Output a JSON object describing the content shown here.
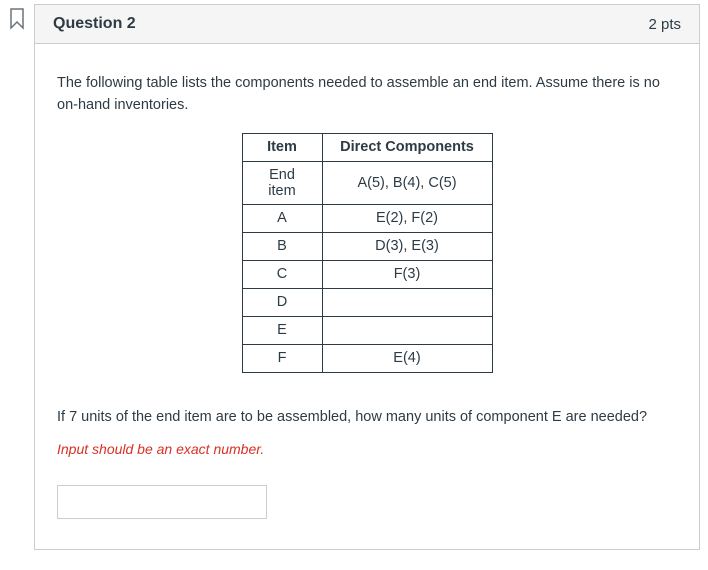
{
  "header": {
    "title": "Question 2",
    "points": "2 pts"
  },
  "body": {
    "intro": "The following table lists the components needed to assemble an end item. Assume there is no on-hand inventories.",
    "table_headers": {
      "item": "Item",
      "components": "Direct Components"
    },
    "prompt": "If 7 units of the end item are to be assembled, how many units of component E are needed?",
    "hint": "Input should be an exact number.",
    "answer_value": ""
  },
  "chart_data": {
    "type": "table",
    "columns": [
      "Item",
      "Direct Components"
    ],
    "rows": [
      {
        "item": "End item",
        "components": "A(5), B(4), C(5)"
      },
      {
        "item": "A",
        "components": "E(2), F(2)"
      },
      {
        "item": "B",
        "components": "D(3), E(3)"
      },
      {
        "item": "C",
        "components": "F(3)"
      },
      {
        "item": "D",
        "components": ""
      },
      {
        "item": "E",
        "components": ""
      },
      {
        "item": "F",
        "components": "E(4)"
      }
    ]
  }
}
